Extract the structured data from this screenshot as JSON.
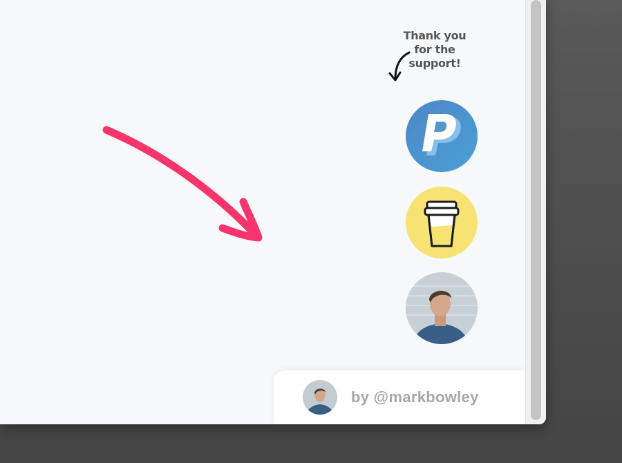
{
  "support": {
    "thanks_line1": "Thank you",
    "thanks_line2": "for the",
    "thanks_line3": "support!"
  },
  "buttons": [
    {
      "name": "paypal",
      "icon": "paypal-icon",
      "color": "#4a90cf"
    },
    {
      "name": "buy-me-a-coffee",
      "icon": "coffee-cup-icon",
      "color": "#f7e374"
    },
    {
      "name": "author-avatar",
      "icon": "avatar"
    }
  ],
  "footer": {
    "credit": "by @markbowley"
  },
  "colors": {
    "accent_arrow": "#f7346b",
    "background": "#f7f8fa",
    "desktop": "#4f4f4f"
  }
}
